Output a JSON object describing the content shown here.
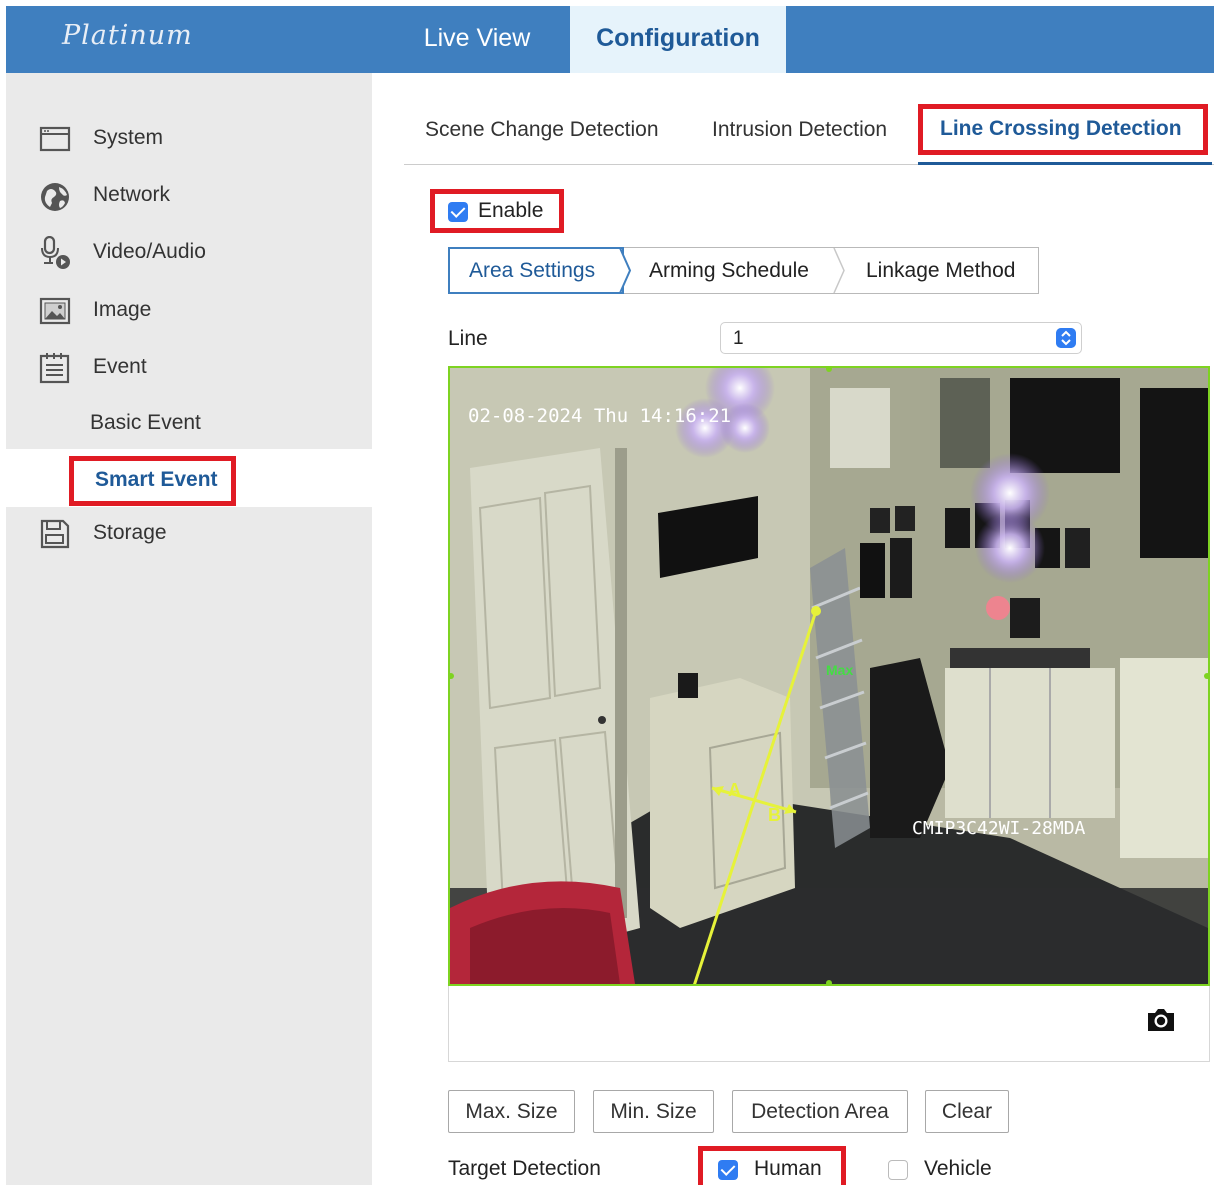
{
  "header": {
    "logo_text": "Platinum",
    "nav": [
      {
        "label": "Live View",
        "active": false
      },
      {
        "label": "Configuration",
        "active": true
      }
    ],
    "accent_color": "#3f7fbf"
  },
  "sidebar": {
    "items": [
      {
        "label": "System",
        "icon": "window-icon"
      },
      {
        "label": "Network",
        "icon": "globe-icon"
      },
      {
        "label": "Video/Audio",
        "icon": "microphone-icon"
      },
      {
        "label": "Image",
        "icon": "image-icon"
      },
      {
        "label": "Event",
        "icon": "calendar-icon"
      },
      {
        "label": "Storage",
        "icon": "floppy-disk-icon"
      }
    ],
    "event_subitems": [
      {
        "label": "Basic Event",
        "active": false
      },
      {
        "label": "Smart Event",
        "active": true
      }
    ]
  },
  "tabs": [
    {
      "label": "Scene Change Detection",
      "active": false
    },
    {
      "label": "Intrusion Detection",
      "active": false
    },
    {
      "label": "Line Crossing Detection",
      "active": true
    }
  ],
  "enable": {
    "label": "Enable",
    "checked": true
  },
  "steps": [
    {
      "label": "Area Settings",
      "active": true
    },
    {
      "label": "Arming Schedule",
      "active": false
    },
    {
      "label": "Linkage Method",
      "active": false
    }
  ],
  "line_select": {
    "label": "Line",
    "value": "1"
  },
  "video": {
    "timestamp": "02-08-2024 Thu 14:16:21",
    "camera_name": "CMIP3C42WI-28MDA",
    "line_end_labels": [
      "A",
      "B"
    ],
    "max_label": "Max"
  },
  "buttons": {
    "max_size": "Max. Size",
    "min_size": "Min. Size",
    "detection_area": "Detection Area",
    "clear": "Clear"
  },
  "target_detection": {
    "label": "Target Detection",
    "options": [
      {
        "label": "Human",
        "checked": true
      },
      {
        "label": "Vehicle",
        "checked": false
      }
    ]
  }
}
